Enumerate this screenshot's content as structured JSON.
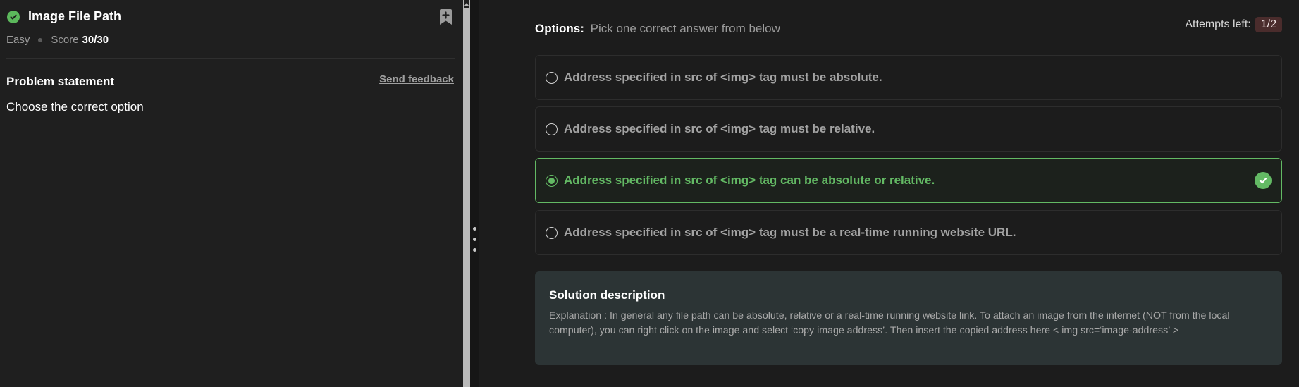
{
  "problem": {
    "title": "Image File Path",
    "difficulty": "Easy",
    "score_label": "Score",
    "score_value": "30/30",
    "statement_heading": "Problem statement",
    "feedback_link": "Send feedback",
    "statement_text": "Choose the correct option"
  },
  "options_panel": {
    "label_strong": "Options:",
    "label_muted": "Pick one correct answer from below",
    "attempts_label": "Attempts left:",
    "attempts_value": "1/2",
    "options": [
      {
        "text": "Address specified in src of <img> tag must be absolute.",
        "selected": false
      },
      {
        "text": "Address specified in src of <img> tag must be relative.",
        "selected": false
      },
      {
        "text": "Address specified in src of <img> tag can be absolute or relative.",
        "selected": true,
        "correct": true
      },
      {
        "text": "Address specified in src of <img> tag must be a real-time running website URL.",
        "selected": false
      }
    ]
  },
  "solution": {
    "heading": "Solution description",
    "text": "Explanation : In general any file path can be absolute, relative or a real-time running website link. To attach an image from the internet (NOT from the local computer), you can right click on the image and select ‘copy image address’. Then insert the copied address here < img src=‘image-address’ >"
  },
  "icons": {
    "title_status": "check-circle-icon",
    "bookmark": "bookmark-plus-icon",
    "correct": "check-circle-icon"
  },
  "colors": {
    "correct_green": "#63b964",
    "attempts_badge_bg": "#4a2c2c",
    "solution_bg": "#2c3435"
  }
}
